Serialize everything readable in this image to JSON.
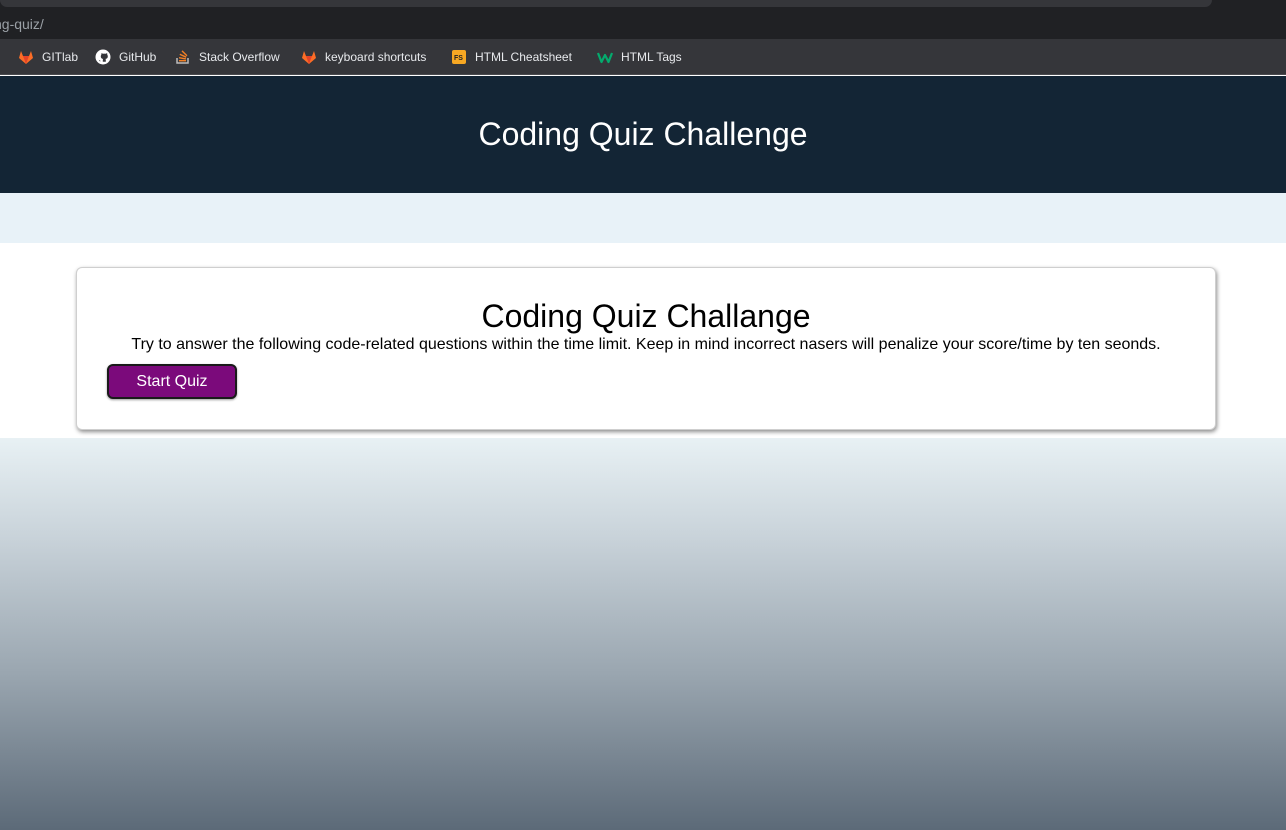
{
  "browser": {
    "url_text": "ng-quiz/",
    "bookmarks": [
      {
        "label": "GITlab",
        "icon": "gitlab-icon"
      },
      {
        "label": "GitHub",
        "icon": "github-icon"
      },
      {
        "label": "Stack Overflow",
        "icon": "stackoverflow-icon"
      },
      {
        "label": "keyboard shortcuts",
        "icon": "gitlab-icon"
      },
      {
        "label": "HTML Cheatsheet",
        "icon": "cheatsheet-icon"
      },
      {
        "label": "HTML Tags",
        "icon": "w3-icon"
      }
    ]
  },
  "header": {
    "title": "Coding Quiz Challenge"
  },
  "card": {
    "title": "Coding Quiz Challange",
    "description": "Try to answer the following code-related questions within the time limit. Keep in mind incorrect nasers will penalize your score/time by ten seonds.",
    "start_label": "Start Quiz"
  },
  "colors": {
    "header_bg": "#132535",
    "button_bg": "#7b0a7b",
    "band_bg": "#e8f2f8"
  }
}
